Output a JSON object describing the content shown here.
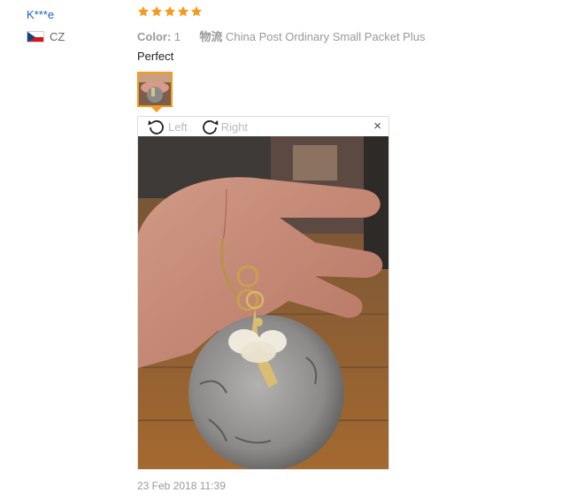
{
  "reviewer": {
    "name": "K***e",
    "country_code": "CZ",
    "flag_icon": "czech-flag-icon"
  },
  "rating": {
    "stars": 5,
    "max": 5,
    "star_color": "#f49b1f"
  },
  "meta": {
    "color_key": "Color:",
    "color_value": "1",
    "shipping_key": "物流",
    "shipping_value": "China Post Ordinary Small Packet Plus"
  },
  "review": {
    "text": "Perfect"
  },
  "viewer": {
    "rotate_left_label": "Left",
    "rotate_right_label": "Right",
    "close_label": "×",
    "thumbnail_border_color": "#f49b1f"
  },
  "date": "23 Feb 2018 11:39"
}
